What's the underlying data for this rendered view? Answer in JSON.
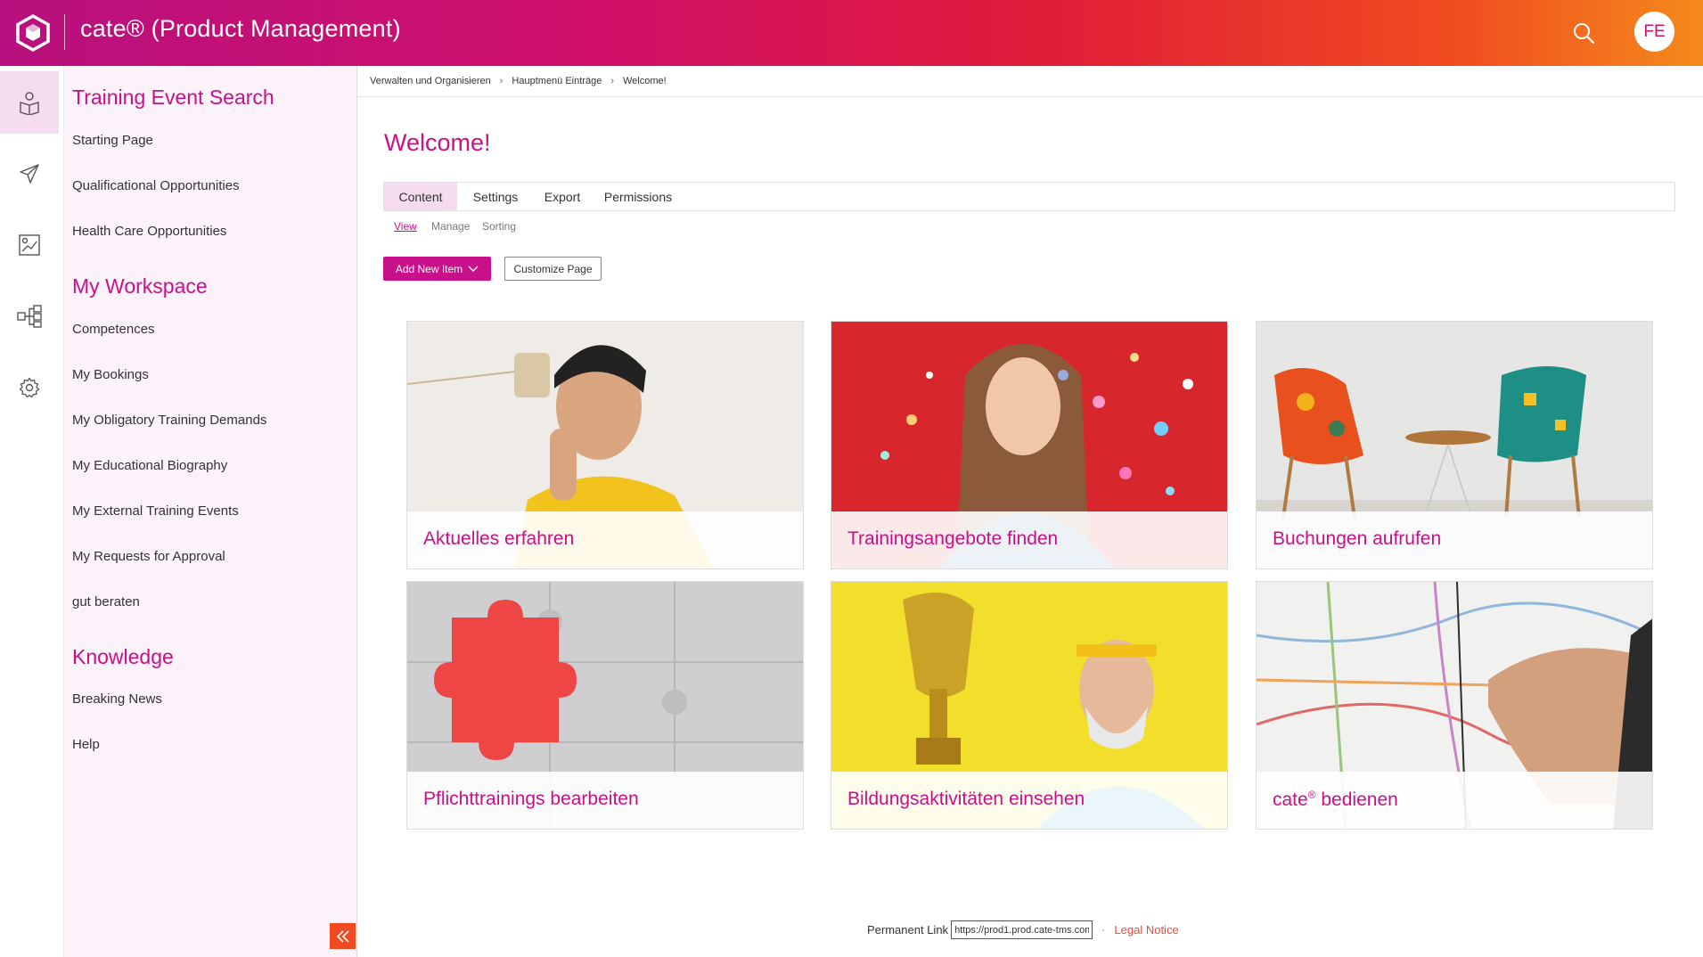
{
  "header": {
    "title": "cate® (Product Management)",
    "avatar_initials": "FE",
    "logo_icon": "cube-hexagon-icon",
    "search_icon": "search-icon"
  },
  "rail": {
    "items": [
      {
        "icon": "training-book-icon",
        "active": true
      },
      {
        "icon": "paper-plane-icon",
        "active": false
      },
      {
        "icon": "report-chart-icon",
        "active": false
      },
      {
        "icon": "org-structure-icon",
        "active": false
      },
      {
        "icon": "gear-icon",
        "active": false
      }
    ]
  },
  "nav": {
    "sections": [
      {
        "heading": "Training Event Search",
        "items": [
          "Starting Page",
          "Qualificational Opportunities",
          "Health Care Opportunities"
        ]
      },
      {
        "heading": "My Workspace",
        "items": [
          "Competences",
          "My Bookings",
          "My Obligatory Training Demands",
          "My Educational Biography",
          "My External Training Events",
          "My Requests for Approval",
          "gut beraten"
        ]
      },
      {
        "heading": "Knowledge",
        "items": [
          "Breaking News",
          "Help"
        ]
      }
    ],
    "collapse_icon": "double-chevron-left-icon"
  },
  "breadcrumb": [
    "Verwalten und Organisieren",
    "Hauptmenü Einträge",
    "Welcome!"
  ],
  "page": {
    "title": "Welcome!",
    "tabs": [
      "Content",
      "Settings",
      "Export",
      "Permissions"
    ],
    "active_tab": "Content",
    "subtabs": [
      "View",
      "Manage",
      "Sorting"
    ],
    "active_subtab": "View",
    "add_button": "Add New Item",
    "customize_button": "Customize Page"
  },
  "tiles": [
    {
      "label": "Aktuelles erfahren"
    },
    {
      "label": "Trainingsangebote finden"
    },
    {
      "label": "Buchungen aufrufen"
    },
    {
      "label": "Pflichttrainings bearbeiten"
    },
    {
      "label": "Bildungsaktivitäten einsehen"
    },
    {
      "label": "cate",
      "sup": "®",
      "suffix": " bedienen"
    }
  ],
  "footer": {
    "permalink_label": "Permanent Link",
    "permalink_value": "https://prod1.prod.cate-tms.com",
    "separator": "·",
    "legal": "Legal Notice"
  },
  "colors": {
    "accent": "#c8108a",
    "orange": "#f04a20",
    "nav_bg": "#fcf2fa",
    "active_bg": "#f6dcef"
  }
}
